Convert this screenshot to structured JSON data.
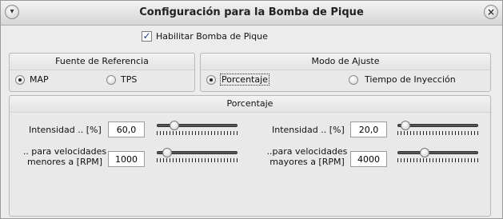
{
  "window": {
    "title": "Configuración para la Bomba de Pique",
    "menu_icon": "chevron-down-icon",
    "close_icon": "close-icon"
  },
  "enable": {
    "label": "Habilitar Bomba de Pique",
    "checked": true
  },
  "fuente": {
    "title": "Fuente de Referencia",
    "options": [
      "MAP",
      "TPS"
    ],
    "selected": "MAP"
  },
  "modo": {
    "title": "Modo de Ajuste",
    "options": [
      "Porcentaje",
      "Tiempo de Inyección"
    ],
    "selected": "Porcentaje"
  },
  "porcentaje": {
    "title": "Porcentaje",
    "left": {
      "intensity_label": "Intensidad .. [%]",
      "intensity_value": "60,0",
      "intensity_slider": 0.18,
      "rpm_label_1": ".. para velocidades",
      "rpm_label_2": "menores a [RPM]",
      "rpm_value": "1000",
      "rpm_slider": 0.08
    },
    "right": {
      "intensity_label": "Intensidad .. [%]",
      "intensity_value": "20,0",
      "intensity_slider": 0.04,
      "rpm_label_1": "..para velocidades",
      "rpm_label_2": "mayores a [RPM]",
      "rpm_value": "4000",
      "rpm_slider": 0.32
    }
  }
}
